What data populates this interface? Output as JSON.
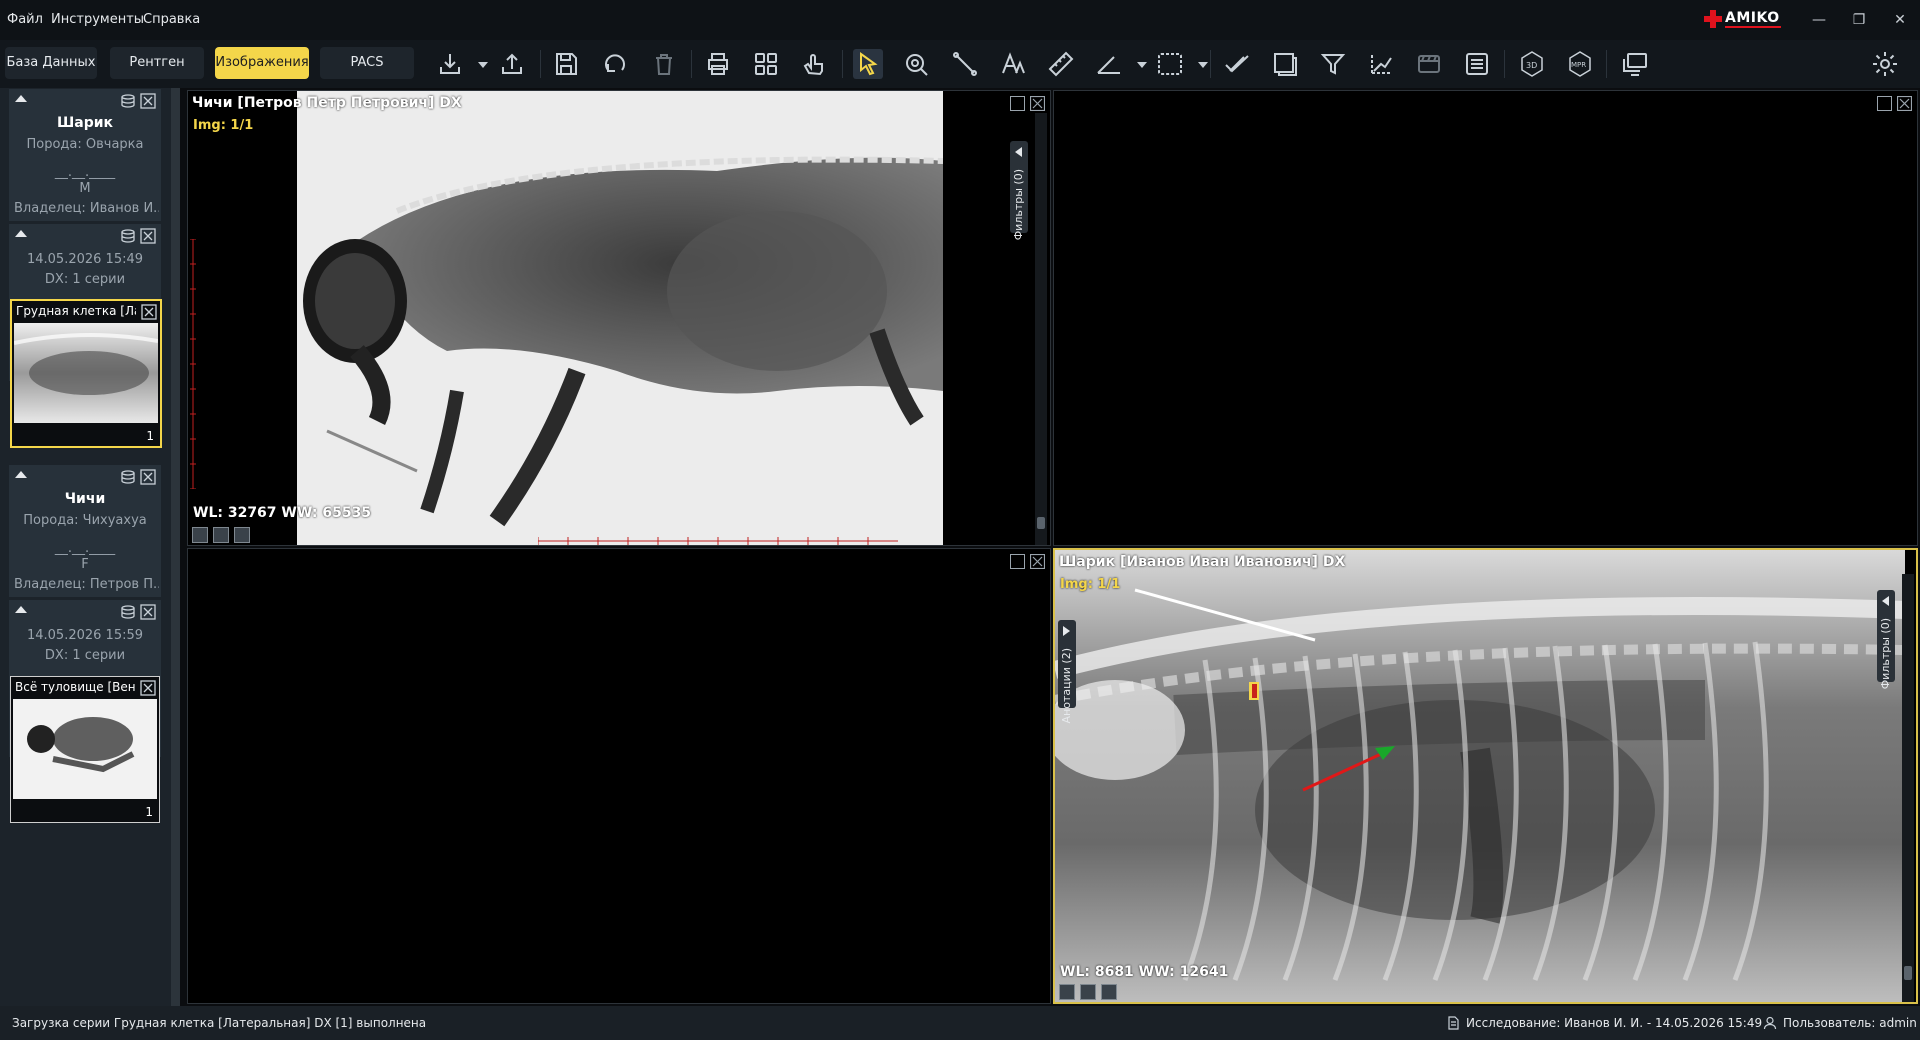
{
  "menu": [
    "Файл",
    "Инструменты",
    "Справка"
  ],
  "brand": "AMIKO",
  "window_controls": [
    "—",
    "❐",
    "✕"
  ],
  "nav": {
    "database": "База Данных",
    "xray": "Рентген",
    "images": "Изображения",
    "pacs": "PACS",
    "active": "images"
  },
  "tools": [
    "download-icon",
    "dropdown-icon",
    "upload-icon",
    "save-icon",
    "rotate-icon",
    "trash-icon",
    "print-icon",
    "grid-icon",
    "hand-icon",
    "pointer-icon",
    "zoom-icon",
    "line-icon",
    "text-icon",
    "ruler-icon",
    "angle-icon",
    "dropdown-icon",
    "select-icon",
    "dropdown-icon",
    "check-icon",
    "crop-icon",
    "filter-icon",
    "measure-icon",
    "film-icon",
    "list-icon",
    "3d-icon",
    "mpr-icon",
    "monitor-icon",
    "settings-icon"
  ],
  "tool_labels": {
    "3d": "3D",
    "mpr": "MPR"
  },
  "patients": [
    {
      "name": "Шарик",
      "breed": "Порода: Овчарка",
      "dob": "__.__.____",
      "sex": "M",
      "owner": "Владелец: Иванов И...",
      "study_date": "14.05.2026 15:49",
      "study_desc": "DX: 1 серии",
      "series": {
        "title": "Грудная клетка [Лат",
        "count": "1",
        "selected": true
      }
    },
    {
      "name": "Чичи",
      "breed": "Порода: Чихуахуа",
      "dob": "__.__.____",
      "sex": "F",
      "owner": "Владелец: Петров П...",
      "study_date": "14.05.2026 15:59",
      "study_desc": "DX: 1 серии",
      "series": {
        "title": "Всё туловище [Вент",
        "count": "1",
        "selected": false
      }
    }
  ],
  "viewports": {
    "top_left": {
      "title": "Чичи [Петров Петр Петрович] DX",
      "img": "Img: 1/1",
      "wl": "WL: 32767 WW: 65535",
      "filters": "Фильтры (0)"
    },
    "bottom_right": {
      "title": "Шарик [Иванов Иван Иванович] DX",
      "img": "Img: 1/1",
      "wl": "WL: 8681 WW: 12641",
      "filters": "Фильтры (0)",
      "annotations": "Анотации (2)"
    }
  },
  "status": {
    "message": "Загрузка серии Грудная клетка [Латеральная] DX [1] выполнена",
    "study": "Исследование: Иванов И. И. - 14.05.2026 15:49",
    "user": "Пользователь: admin"
  },
  "colors": {
    "accent": "#f4d64a",
    "brand": "#e0121d",
    "arrow": "#e01818",
    "arrow_head": "#19a82a"
  }
}
